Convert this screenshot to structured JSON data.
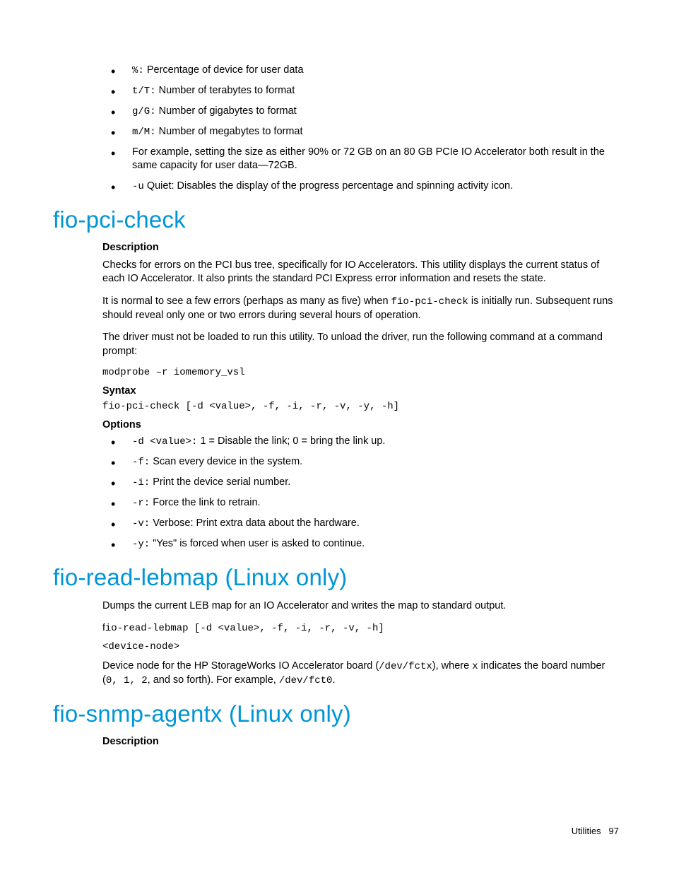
{
  "topList": {
    "i1_a": "%:",
    "i1_b": " Percentage of device for user data",
    "i2_a": "t/T:",
    "i2_b": " Number of terabytes to format",
    "i3_a": "g/G:",
    "i3_b": " Number of gigabytes to format",
    "i4_a": "m/M:",
    "i4_b": " Number of megabytes to format",
    "i5": "For example, setting the size as either 90% or 72 GB on an 80 GB PCIe IO Accelerator both result in the same capacity for user data—72GB.",
    "i6_a": "-u",
    "i6_b": " Quiet: Disables the display of the progress percentage and spinning activity icon."
  },
  "sec1": {
    "title": "fio-pci-check",
    "desc_h": "Description",
    "p1": "Checks for errors on the PCI bus tree, specifically for IO Accelerators. This utility displays the current status of each IO Accelerator. It also prints the standard PCI Express error information and resets the state.",
    "p2a": "It is normal to see a few errors (perhaps as many as five) when ",
    "p2b": "fio-pci-check",
    "p2c": " is initially run. Subsequent runs should reveal only one or two errors during several hours of operation.",
    "p3": "The driver must not be loaded to run this utility. To unload the driver, run the following command at a command prompt:",
    "code1": "modprobe –r iomemory_vsl",
    "syntax_h": "Syntax",
    "code2": "fio-pci-check [-d <value>, -f, -i, -r, -v, -y, -h]",
    "options_h": "Options",
    "opts": {
      "o1a": "-d <value>:",
      "o1b": " 1 = Disable the link; 0 = bring the link up.",
      "o2a": "-f:",
      "o2b": " Scan every device in the system.",
      "o3a": "-i:",
      "o3b": " Print the device serial number.",
      "o4a": "-r:",
      "o4b": " Force the link to retrain.",
      "o5a": "-v:",
      "o5b": " Verbose: Print extra data about the hardware.",
      "o6a": "-y:",
      "o6b": " \"Yes\" is forced when user is asked to continue."
    }
  },
  "sec2": {
    "title": "fio-read-lebmap (Linux only)",
    "p1": "Dumps the current LEB map for an IO Accelerator and writes the map to standard output.",
    "code_pre": "f",
    "code": "io-read-lebmap [-d <value>, -f, -i, -r, -v, -h]",
    "code2": "<device-node>",
    "p2a": "Device node for the HP StorageWorks IO Accelerator board (",
    "p2b": "/dev/fctx",
    "p2c": "), where ",
    "p2d": "x",
    "p2e": " indicates the board number (",
    "p2f": "0, 1, 2",
    "p2g": ", and so forth). For example, ",
    "p2h": "/dev/fct0",
    "p2i": "."
  },
  "sec3": {
    "title": "fio-snmp-agentx (Linux only)",
    "desc_h": "Description"
  },
  "footer": {
    "label": "Utilities",
    "page": "97"
  }
}
